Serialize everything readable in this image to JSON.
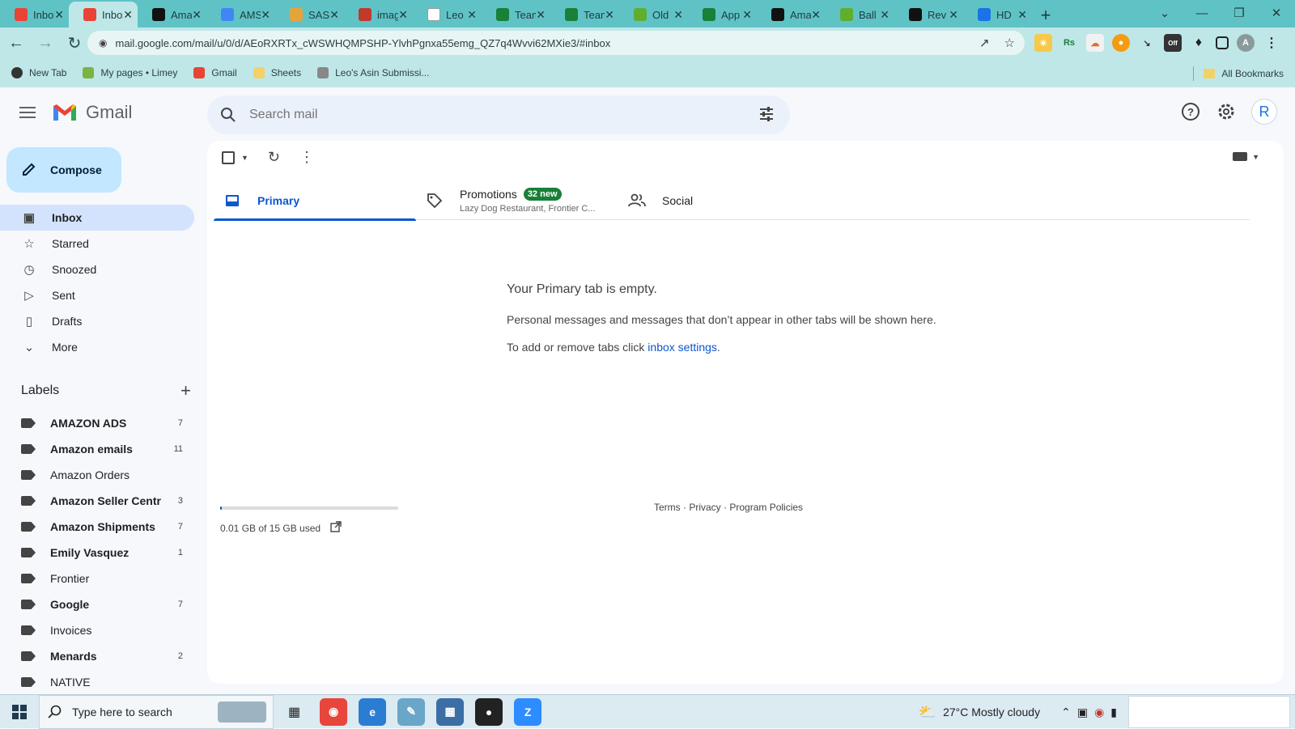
{
  "browser": {
    "tabs": [
      {
        "title": "Inbox",
        "favicon": "gmail-icon",
        "color": "#ea4335",
        "active": false
      },
      {
        "title": "Inbox",
        "favicon": "gmail-icon",
        "color": "#ea4335",
        "active": true
      },
      {
        "title": "Amazon",
        "favicon": "amazon-icon",
        "color": "#111111",
        "active": false
      },
      {
        "title": "AMS",
        "favicon": "ams-icon",
        "color": "#4285f4",
        "active": false
      },
      {
        "title": "SAS",
        "favicon": "sas-icon",
        "color": "#e6a23c",
        "active": false
      },
      {
        "title": "images",
        "favicon": "images-icon",
        "color": "#c0392b",
        "active": false
      },
      {
        "title": "Leo",
        "favicon": "leo-icon",
        "color": "#ffffff",
        "active": false
      },
      {
        "title": "Team",
        "favicon": "sheets-plus-icon",
        "color": "#188038",
        "active": false
      },
      {
        "title": "Team",
        "favicon": "sheets-plus-icon",
        "color": "#188038",
        "active": false
      },
      {
        "title": "Old",
        "favicon": "w-icon",
        "color": "#5fae2e",
        "active": false
      },
      {
        "title": "App",
        "favicon": "sheets-plus-icon",
        "color": "#188038",
        "active": false
      },
      {
        "title": "Amazon",
        "favicon": "amazon-icon",
        "color": "#111111",
        "active": false
      },
      {
        "title": "Ball",
        "favicon": "w-icon",
        "color": "#5fae2e",
        "active": false
      },
      {
        "title": "Rev",
        "favicon": "amazon-icon",
        "color": "#111111",
        "active": false
      },
      {
        "title": "HD",
        "favicon": "c-icon",
        "color": "#1a73e8",
        "active": false
      }
    ],
    "url": "mail.google.com/mail/u/0/d/AEoRXRTx_cWSWHQMPSHP-YlvhPgnxa55emg_QZ7q4Wvvi62MXie3/#inbox",
    "bookmarks": [
      {
        "label": "New Tab",
        "icon": "globe-icon"
      },
      {
        "label": "My pages • Limey",
        "icon": "limey-icon"
      },
      {
        "label": "Gmail",
        "icon": "gmail-icon"
      },
      {
        "label": "Sheets",
        "icon": "folder-icon"
      },
      {
        "label": "Leo's Asin Submissi...",
        "icon": "leo-icon"
      }
    ],
    "all_bookmarks": "All Bookmarks",
    "profile_initial": "A"
  },
  "gmail": {
    "app_name": "Gmail",
    "search_placeholder": "Search mail",
    "avatar_initial": "R",
    "compose_label": "Compose",
    "nav": [
      {
        "label": "Inbox",
        "icon": "inbox-icon",
        "active": true
      },
      {
        "label": "Starred",
        "icon": "star-icon",
        "active": false
      },
      {
        "label": "Snoozed",
        "icon": "clock-icon",
        "active": false
      },
      {
        "label": "Sent",
        "icon": "send-icon",
        "active": false
      },
      {
        "label": "Drafts",
        "icon": "draft-icon",
        "active": false
      },
      {
        "label": "More",
        "icon": "chevron-down-icon",
        "active": false
      }
    ],
    "labels_heading": "Labels",
    "labels": [
      {
        "name": "AMAZON ADS",
        "count": "7",
        "bold": true
      },
      {
        "name": "Amazon emails",
        "count": "11",
        "bold": true
      },
      {
        "name": "Amazon Orders",
        "count": "",
        "bold": false
      },
      {
        "name": "Amazon Seller Centr",
        "count": "3",
        "bold": true
      },
      {
        "name": "Amazon Shipments",
        "count": "7",
        "bold": true
      },
      {
        "name": "Emily Vasquez",
        "count": "1",
        "bold": true
      },
      {
        "name": "Frontier",
        "count": "",
        "bold": false
      },
      {
        "name": "Google",
        "count": "7",
        "bold": true
      },
      {
        "name": "Invoices",
        "count": "",
        "bold": false
      },
      {
        "name": "Menards",
        "count": "2",
        "bold": true
      },
      {
        "name": "NATIVE",
        "count": "",
        "bold": false
      }
    ],
    "inbox_tabs": {
      "primary": "Primary",
      "promotions": "Promotions",
      "promotions_badge": "32 new",
      "promotions_sub": "Lazy Dog Restaurant, Frontier C...",
      "social": "Social"
    },
    "empty_title": "Your Primary tab is empty.",
    "empty_body": "Personal messages and messages that don’t appear in other tabs will be shown here.",
    "empty_settings_prefix": "To add or remove tabs click ",
    "empty_settings_link": "inbox settings",
    "empty_settings_suffix": ".",
    "storage_text": "0.01 GB of 15 GB used",
    "storage_fraction": 0.001,
    "footer": {
      "terms": "Terms",
      "privacy": "Privacy",
      "policies": "Program Policies",
      "sep": " · "
    }
  },
  "taskbar": {
    "search_placeholder": "Type here to search",
    "weather": "27°C  Mostly cloudy",
    "apps": [
      {
        "name": "chrome-icon",
        "color": "#e8453c"
      },
      {
        "name": "edge-icon",
        "color": "#2b7cd3"
      },
      {
        "name": "notepad-icon",
        "color": "#6aa6c8"
      },
      {
        "name": "calculator-icon",
        "color": "#3a6ea5"
      },
      {
        "name": "record-icon",
        "color": "#222222"
      },
      {
        "name": "zoom-icon",
        "color": "#2d8cff"
      }
    ]
  }
}
